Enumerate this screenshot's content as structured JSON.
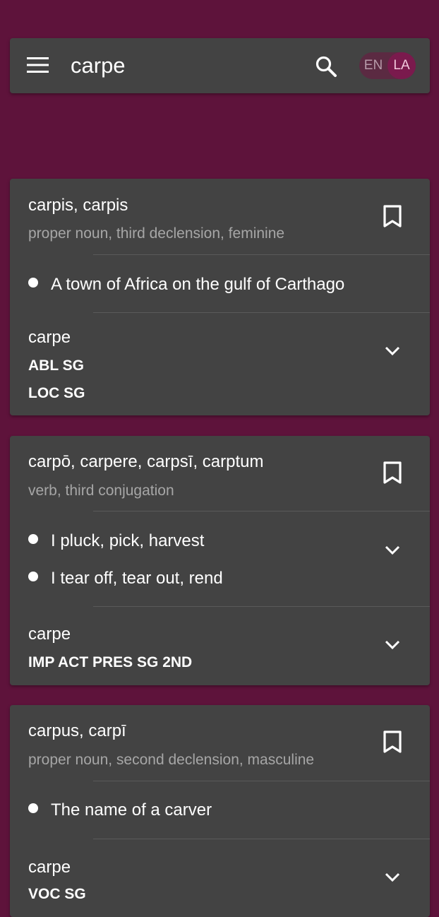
{
  "header": {
    "search_value": "carpe",
    "lang_en": "EN",
    "lang_la": "LA",
    "icons": [
      "menu-icon",
      "search-icon"
    ]
  },
  "results": [
    {
      "title": "carpis, carpis",
      "subtitle": "proper noun, third declension, feminine",
      "definitions": [
        "A town of Africa on the gulf of Carthago"
      ],
      "form": "carpe",
      "tags": [
        "ABL SG",
        "LOC SG"
      ]
    },
    {
      "title": "carpō, carpere, carpsī, carptum",
      "subtitle": "verb, third conjugation",
      "definitions": [
        "I pluck, pick, harvest",
        "I tear off, tear out, rend"
      ],
      "form": "carpe",
      "tags": [
        "IMP ACT PRES SG 2ND"
      ]
    },
    {
      "title": "carpus, carpī",
      "subtitle": "proper noun, second declension, masculine",
      "definitions": [
        "The name of a carver"
      ],
      "form": "carpe",
      "tags": [
        "VOC SG"
      ]
    }
  ],
  "colors": {
    "background": "#5e133b",
    "card": "#434343",
    "accent": "#7a1a4d",
    "secondary_text": "#a6a6a6"
  }
}
